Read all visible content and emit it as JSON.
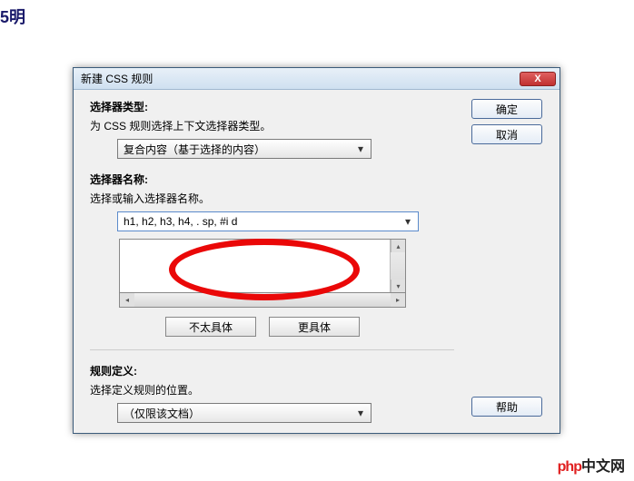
{
  "outer_text": "5明",
  "dialog": {
    "title": "新建 CSS 规则",
    "close_label": "X"
  },
  "selector_type": {
    "label": "选择器类型:",
    "desc": "为 CSS 规则选择上下文选择器类型。",
    "value": "复合内容（基于选择的内容）"
  },
  "selector_name": {
    "label": "选择器名称:",
    "desc": "选择或输入选择器名称。",
    "value": "h1, h2, h3, h4, . sp, #i d"
  },
  "specificity": {
    "less_specific": "不太具体",
    "more_specific": "更具体"
  },
  "rule_def": {
    "label": "规则定义:",
    "desc": "选择定义规则的位置。",
    "value": "（仅限该文档）"
  },
  "buttons": {
    "ok": "确定",
    "cancel": "取消",
    "help": "帮助"
  },
  "watermark": {
    "logo": "php",
    "text": "中文网"
  }
}
